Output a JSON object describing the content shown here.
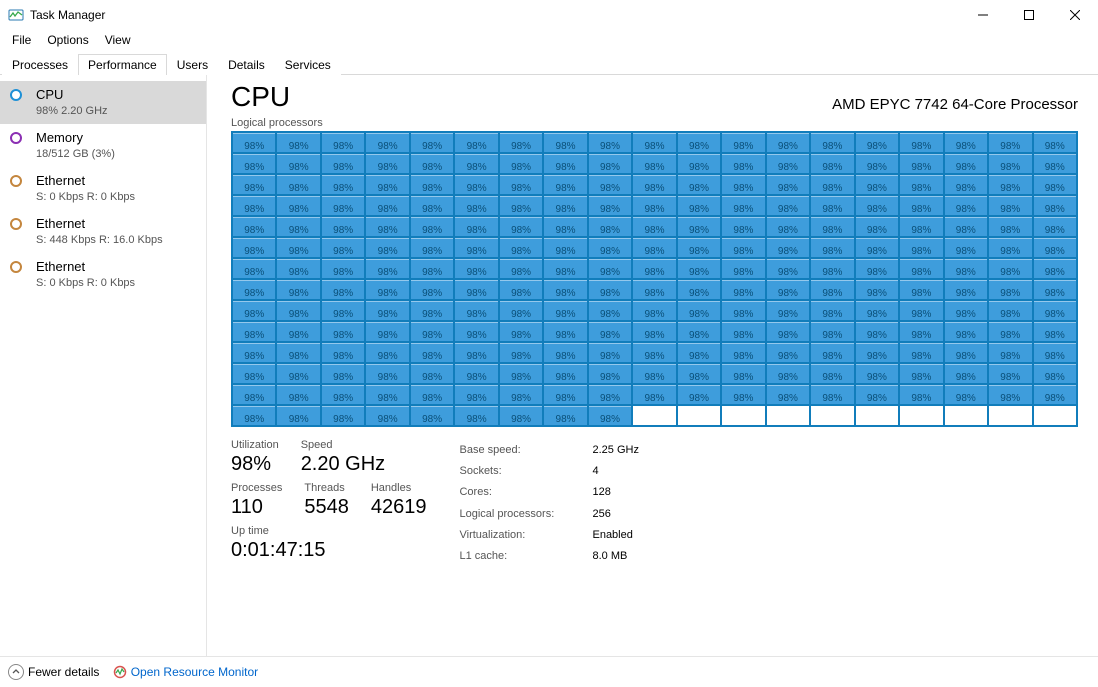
{
  "window": {
    "title": "Task Manager"
  },
  "menu": {
    "file": "File",
    "options": "Options",
    "view": "View"
  },
  "tabs": {
    "processes": "Processes",
    "performance": "Performance",
    "users": "Users",
    "details": "Details",
    "services": "Services"
  },
  "sidebar": {
    "cpu": {
      "title": "CPU",
      "sub": "98%  2.20 GHz",
      "color": "#1e90d6"
    },
    "memory": {
      "title": "Memory",
      "sub": "18/512 GB (3%)",
      "color": "#8b2fb3"
    },
    "eth0": {
      "title": "Ethernet",
      "sub": "S: 0 Kbps  R: 0 Kbps",
      "color": "#c4863e"
    },
    "eth1": {
      "title": "Ethernet",
      "sub": "S: 448 Kbps  R: 16.0 Kbps",
      "color": "#c4863e"
    },
    "eth2": {
      "title": "Ethernet",
      "sub": "S: 0 Kbps  R: 0 Kbps",
      "color": "#c4863e"
    }
  },
  "header": {
    "title": "CPU",
    "device": "AMD EPYC 7742 64-Core Processor",
    "subtitle": "Logical processors"
  },
  "chart_data": {
    "type": "heatmap",
    "rows": 14,
    "cols": 19,
    "populated_cells": 256,
    "cell_value_percent": 98,
    "cell_label": "98%"
  },
  "stats": {
    "utilization_label": "Utilization",
    "utilization": "98%",
    "speed_label": "Speed",
    "speed": "2.20 GHz",
    "processes_label": "Processes",
    "processes": "110",
    "threads_label": "Threads",
    "threads": "5548",
    "handles_label": "Handles",
    "handles": "42619",
    "uptime_label": "Up time",
    "uptime": "0:01:47:15",
    "base_speed_label": "Base speed:",
    "base_speed": "2.25 GHz",
    "sockets_label": "Sockets:",
    "sockets": "4",
    "cores_label": "Cores:",
    "cores": "128",
    "lp_label": "Logical processors:",
    "lp": "256",
    "virt_label": "Virtualization:",
    "virt": "Enabled",
    "l1_label": "L1 cache:",
    "l1": "8.0 MB"
  },
  "footer": {
    "fewer": "Fewer details",
    "orm": "Open Resource Monitor"
  }
}
